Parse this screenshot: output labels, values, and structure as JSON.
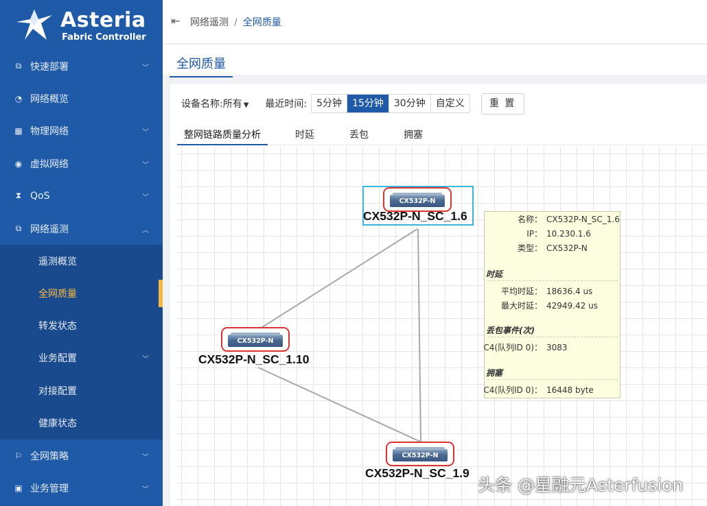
{
  "brand": {
    "name": "Asteria",
    "subtitle": "Fabric Controller"
  },
  "sidebar": {
    "items": [
      {
        "label": "快速部署",
        "icon": "deploy-icon",
        "expandable": true
      },
      {
        "label": "网络概览",
        "icon": "dashboard-icon",
        "expandable": false
      },
      {
        "label": "物理网络",
        "icon": "grid-icon",
        "expandable": true
      },
      {
        "label": "虚拟网络",
        "icon": "eye-icon",
        "expandable": true
      },
      {
        "label": "QoS",
        "icon": "hourglass-icon",
        "expandable": true
      },
      {
        "label": "网络遥测",
        "icon": "telemetry-icon",
        "expandable": true,
        "expanded": true
      },
      {
        "label": "全网策略",
        "icon": "flag-icon",
        "expandable": true
      },
      {
        "label": "业务管理",
        "icon": "square-icon",
        "expandable": true
      }
    ],
    "submenu": [
      {
        "label": "遥测概览"
      },
      {
        "label": "全网质量",
        "active": true
      },
      {
        "label": "转发状态"
      },
      {
        "label": "业务配置",
        "expandable": true
      },
      {
        "label": "对接配置"
      },
      {
        "label": "健康状态"
      }
    ]
  },
  "header": {
    "breadcrumb": [
      "网络遥测",
      "全网质量"
    ],
    "separator": "/"
  },
  "page": {
    "title": "全网质量"
  },
  "filters": {
    "device_label": "设备名称:所有",
    "time_label": "最近时间:",
    "time_options": [
      "5分钟",
      "15分钟",
      "30分钟",
      "自定义"
    ],
    "time_selected": "15分钟",
    "reset_label": "重 置"
  },
  "tabs": [
    "整网链路质量分析",
    "时延",
    "丢包",
    "拥塞"
  ],
  "active_tab": "整网链路质量分析",
  "topology": {
    "nodes": [
      {
        "id": "n16",
        "model": "CX532P-N",
        "name": "CX532P-N_SC_1.6",
        "selected": true
      },
      {
        "id": "n110",
        "model": "CX532P-N",
        "name": "CX532P-N_SC_1.10",
        "selected": false
      },
      {
        "id": "n19",
        "model": "CX532P-N",
        "name": "CX532P-N_SC_1.9",
        "selected": false
      }
    ],
    "links": [
      [
        "n16",
        "n110"
      ],
      [
        "n16",
        "n19"
      ],
      [
        "n110",
        "n19"
      ]
    ]
  },
  "tooltip": {
    "name_key": "名称：",
    "name_val": "CX532P-N_SC_1.6",
    "ip_key": "IP：",
    "ip_val": "10.230.1.6",
    "type_key": "类型：",
    "type_val": "CX532P-N",
    "latency_title": "时延",
    "avg_key": "平均时延：",
    "avg_val": "18636.4 us",
    "max_key": "最大时延：",
    "max_val": "42949.42 us",
    "drop_title": "丢包事件(次)",
    "drop_key": "C4(队列ID 0)：",
    "drop_val": "3083",
    "cong_title": "拥塞",
    "cong_key": "C4(队列ID 0)：",
    "cong_val": "16448 byte"
  },
  "watermark": "头条 @星融元Asterfusion",
  "colors": {
    "sidebar": "#1f5aa8",
    "submenu": "#1a4a8e",
    "active": "#f5b940",
    "accent": "#1f5aa8",
    "node_border": "#dd3333",
    "selection": "#37b6e0"
  }
}
